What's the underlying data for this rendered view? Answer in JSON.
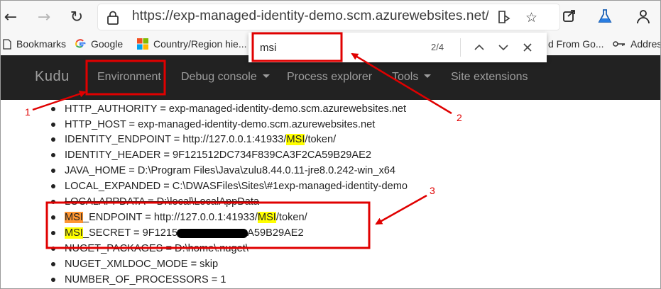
{
  "browser": {
    "url": "https://exp-managed-identity-demo.scm.azurewebsites.net/En...",
    "icons": [
      "back-arrow-icon",
      "forward-arrow-icon",
      "refresh-icon",
      "lock-icon",
      "reading-view-icon",
      "favorite-star-icon",
      "share-icon",
      "flask-icon",
      "profile-icon"
    ]
  },
  "bookmarks": [
    {
      "label": "Bookmarks",
      "icon": "file-icon"
    },
    {
      "label": "Google",
      "icon": "google-icon"
    },
    {
      "label": "Country/Region hie...",
      "icon": "microsoft-icon"
    },
    {
      "label": "d From Go...",
      "icon": ""
    },
    {
      "label": "Addres",
      "icon": "key-icon"
    }
  ],
  "find": {
    "query": "msi",
    "count": "2/4"
  },
  "kudu": {
    "brand": "Kudu",
    "nav": [
      {
        "label": "Environment",
        "dropdown": false
      },
      {
        "label": "Debug console",
        "dropdown": true
      },
      {
        "label": "Process explorer",
        "dropdown": false
      },
      {
        "label": "Tools",
        "dropdown": true
      },
      {
        "label": "Site extensions",
        "dropdown": false
      }
    ]
  },
  "env": [
    {
      "text": "HTTP_AUTHORITY = exp-managed-identity-demo.scm.azurewebsites.net"
    },
    {
      "text": "HTTP_HOST = exp-managed-identity-demo.scm.azurewebsites.net"
    },
    {
      "pre": "IDENTITY_ENDPOINT = http://127.0.0.1:41933/",
      "match": "MSI",
      "post": "/token/"
    },
    {
      "text": "IDENTITY_HEADER = 9F121512DC734F839CA3F2CA59B29AE2"
    },
    {
      "text": "JAVA_HOME = D:\\Program Files\\Java\\zulu8.44.0.11-jre8.0.242-win_x64"
    },
    {
      "text": "LOCAL_EXPANDED = C:\\DWASFiles\\Sites\\#1exp-managed-identity-demo"
    },
    {
      "text": "LOCALAPPDATA = D:\\local\\LocalAppData"
    },
    {
      "match_active": "MSI",
      "mid": "_ENDPOINT = http://127.0.0.1:41933/",
      "match": "MSI",
      "post": "/token/"
    },
    {
      "match": "MSI",
      "pre_secret": "_SECRET = 9F1215",
      "post": "A59B29AE2"
    },
    {
      "text": "NUGET_PACKAGES = D:\\home\\.nuget\\"
    },
    {
      "text": "NUGET_XMLDOC_MODE = skip"
    },
    {
      "text": "NUMBER_OF_PROCESSORS = 1"
    }
  ],
  "annotations": {
    "labels": [
      "1",
      "2",
      "3"
    ],
    "color": "#e00000"
  }
}
